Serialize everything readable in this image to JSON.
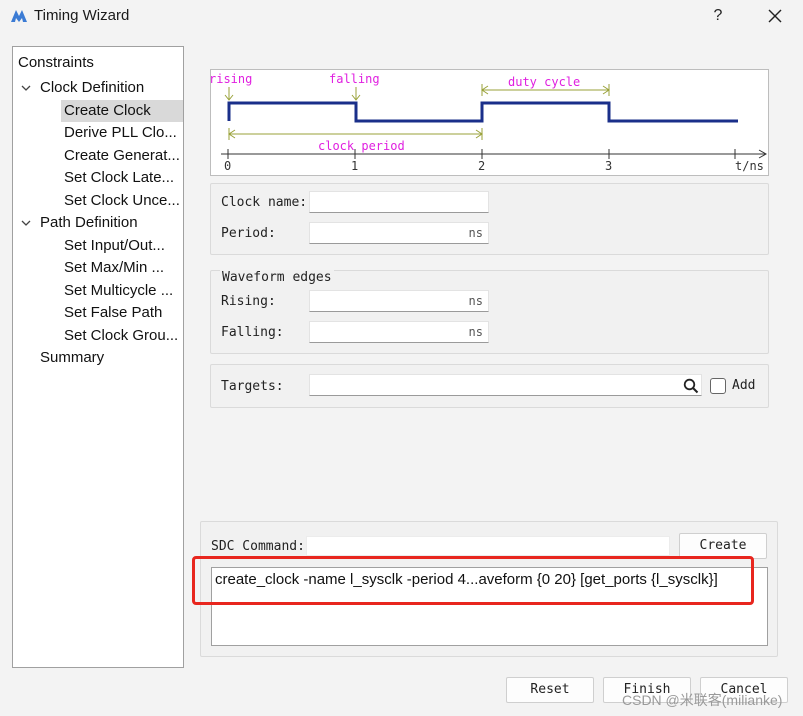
{
  "window": {
    "title": "Timing Wizard",
    "help": "?",
    "close": "×"
  },
  "tree": {
    "items": [
      {
        "label": "Constraints"
      },
      {
        "label": "Clock Definition"
      },
      {
        "label": "Create Clock"
      },
      {
        "label": "Derive PLL Clo..."
      },
      {
        "label": "Create Generat..."
      },
      {
        "label": "Set Clock Late..."
      },
      {
        "label": "Set Clock Unce..."
      },
      {
        "label": "Path Definition"
      },
      {
        "label": "Set Input/Out..."
      },
      {
        "label": "Set Max/Min ..."
      },
      {
        "label": "Set Multicycle ..."
      },
      {
        "label": "Set False Path"
      },
      {
        "label": "Set Clock Grou..."
      },
      {
        "label": "Summary"
      }
    ]
  },
  "diagram": {
    "rising": "rising",
    "falling": "falling",
    "duty_cycle": "duty cycle",
    "clock_period": "clock period",
    "ticks": [
      "0",
      "1",
      "2",
      "3"
    ],
    "axis_unit": "t/ns",
    "label_color": "#e020e0",
    "arrow_color": "#9aa23a",
    "wave_color": "#1a2f8a"
  },
  "clock": {
    "name_label": "Clock name:",
    "name_value": "",
    "period_label": "Period:",
    "period_unit": "ns"
  },
  "waveform": {
    "legend": "Waveform edges",
    "rising_label": "Rising:",
    "rising_unit": "ns",
    "falling_label": "Falling:",
    "falling_unit": "ns"
  },
  "targets": {
    "label": "Targets:",
    "add_label": "Add",
    "search_icon": "search-icon"
  },
  "sdc": {
    "label": "SDC Command:",
    "create_button": "Create",
    "command": "create_clock -name l_sysclk -period 4...aveform {0 20} [get_ports {l_sysclk}]",
    "highlight_color": "#e8261e"
  },
  "buttons": {
    "reset": "Reset",
    "finish": "Finish",
    "cancel": "Cancel"
  },
  "watermark": "CSDN @米联客(milianke)"
}
